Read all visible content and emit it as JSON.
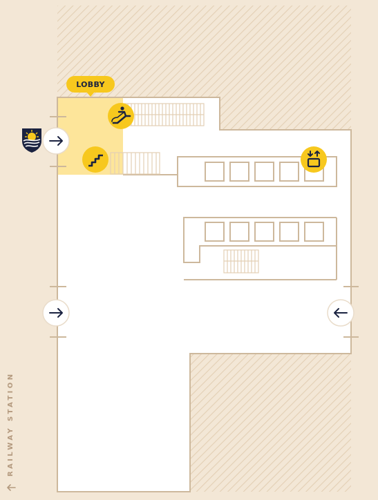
{
  "map": {
    "lobby_label": "LOBBY",
    "railway_label": "RAILWAY STATION",
    "icons": {
      "escalator": "escalator-icon",
      "stairs": "stairs-icon",
      "lift": "lift-icon",
      "logo": "university-crest-logo"
    },
    "colors": {
      "background": "#f3e7d6",
      "floor": "#ffffff",
      "wall": "#cdb89c",
      "hatch": "#e3cfb4",
      "lobby_highlight": "#fde59a",
      "accent_yellow": "#f7c81e",
      "navy": "#1a2240"
    }
  }
}
